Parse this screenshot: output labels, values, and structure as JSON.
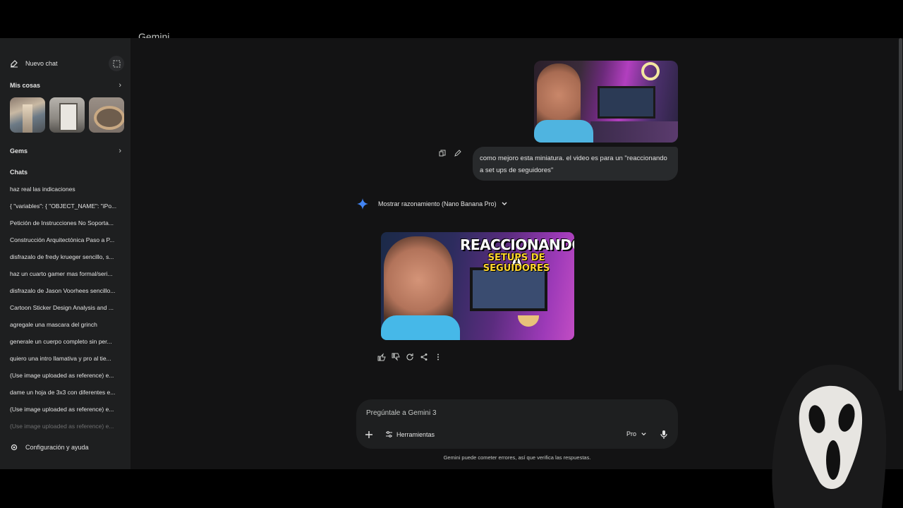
{
  "header": {
    "title": "Gemini"
  },
  "sidebar": {
    "new_chat": "Nuevo chat",
    "my_stuff": "Mis cosas",
    "gems": "Gems",
    "chats_heading": "Chats",
    "chats": [
      "haz real las indicaciones",
      "{ \"variables\": { \"OBJECT_NAME\": \"iPo...",
      "Petición de Instrucciones No Soporta...",
      "Construcción Arquitectónica Paso a P...",
      "disfrazalo de fredy krueger sencillo, s...",
      "haz un cuarto gamer mas formal/seri...",
      "disfrazalo de Jason Voorhees sencillo...",
      "Cartoon Sticker Design Analysis and ...",
      "agregale una mascara del grinch",
      "generale un cuerpo completo sin per...",
      "quiero una intro llamativa y pro al tie...",
      "(Use image uploaded as reference) e...",
      "dame un hoja de 3x3 con diferentes e...",
      "(Use image uploaded as reference) e...",
      "(Use image uploaded as reference) e..."
    ],
    "settings": "Configuración y ayuda"
  },
  "conversation": {
    "user_message": "como mejoro esta miniatura. el video es para un \"reaccionando a set ups de seguidores\"",
    "reasoning_toggle": "Mostrar razonamiento (Nano Banana Pro)",
    "generated_image_text": {
      "line1": "REACCIONANDO A",
      "line2": "SETUPS DE SEGUIDORES"
    }
  },
  "composer": {
    "placeholder": "Pregúntale a Gemini 3",
    "tools": "Herramientas",
    "model": "Pro"
  },
  "disclaimer": "Gemini puede cometer errores, así que verifica las respuestas.",
  "colors": {
    "accent_blue": "#4285f4",
    "background": "#131314",
    "sidebar": "#1e1f20"
  }
}
